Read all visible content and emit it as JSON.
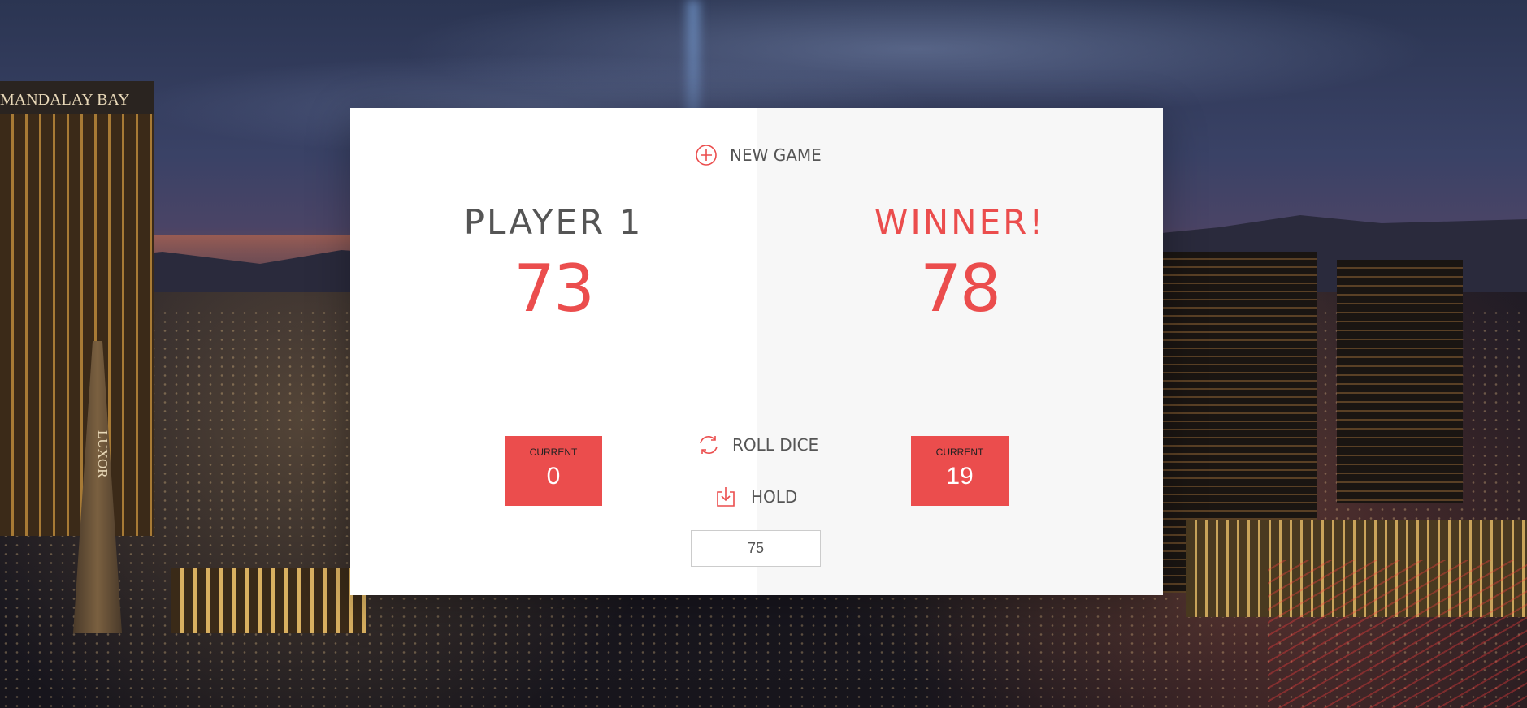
{
  "background": {
    "mandalay_sign": "MANDALAY BAY",
    "luxor_sign": "LUXOR"
  },
  "colors": {
    "accent": "#eb4d4d",
    "text": "#555555",
    "active_panel": "#f7f7f7",
    "inactive_panel": "#ffffff"
  },
  "controls": {
    "new_game": {
      "label": "NEW GAME",
      "icon": "plus-circle-icon"
    },
    "roll_dice": {
      "label": "ROLL DICE",
      "icon": "refresh-icon"
    },
    "hold": {
      "label": "HOLD",
      "icon": "download-icon"
    },
    "final_score": {
      "value": "75"
    }
  },
  "players": [
    {
      "name": "PLAYER 1",
      "score": "73",
      "current_label": "CURRENT",
      "current": "0"
    },
    {
      "name": "WINNER!",
      "score": "78",
      "current_label": "CURRENT",
      "current": "19"
    }
  ]
}
